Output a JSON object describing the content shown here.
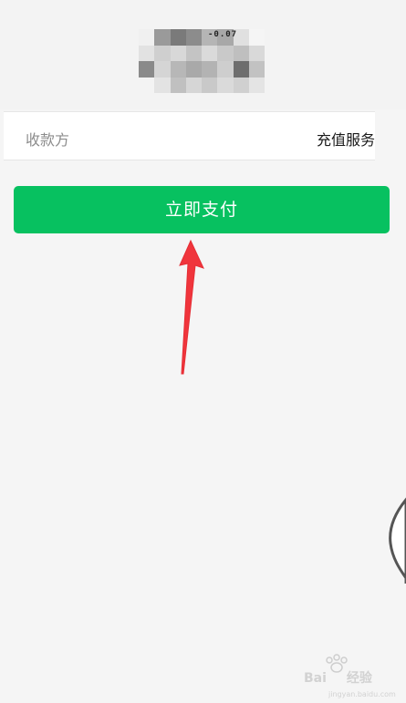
{
  "payment": {
    "amount_text": "-0.07"
  },
  "payee": {
    "label": "收款方",
    "value": "充值服务"
  },
  "actions": {
    "pay_label": "立即支付"
  },
  "watermark": {
    "text": "Bai",
    "text2": "经验",
    "sub": "jingyan.baidu.com"
  },
  "colors": {
    "pay_button": "#07c160",
    "arrow": "#f0353c",
    "page_bg": "#f5f5f5"
  }
}
